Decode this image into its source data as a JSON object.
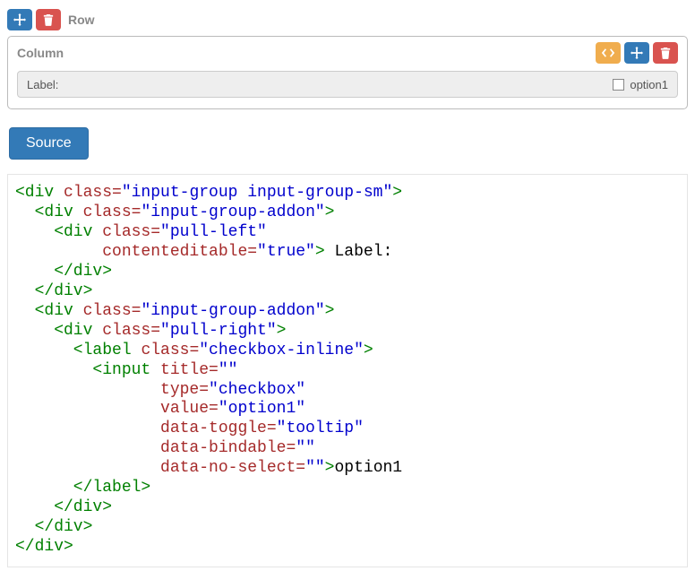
{
  "row": {
    "label": "Row"
  },
  "column": {
    "label": "Column",
    "input_label": "Label:",
    "option_label": "option1"
  },
  "source_button": "Source",
  "code": {
    "l1a": "<div ",
    "l1b": "class=",
    "l1c": "\"input-group input-group-sm\"",
    "l1d": ">",
    "l2a": "  <div ",
    "l2b": "class=",
    "l2c": "\"input-group-addon\"",
    "l2d": ">",
    "l3a": "    <div ",
    "l3b": "class=",
    "l3c": "\"pull-left\"",
    "l4b": "         contenteditable=",
    "l4c": "\"true\"",
    "l4d": "> Label:",
    "l5": "    </div>",
    "l6": "  </div>",
    "l7a": "  <div ",
    "l7b": "class=",
    "l7c": "\"input-group-addon\"",
    "l7d": ">",
    "l8a": "    <div ",
    "l8b": "class=",
    "l8c": "\"pull-right\"",
    "l8d": ">",
    "l9a": "      <label ",
    "l9b": "class=",
    "l9c": "\"checkbox-inline\"",
    "l9d": ">",
    "l10a": "        <input ",
    "l10b": "title=",
    "l10c": "\"\"",
    "l11b": "               type=",
    "l11c": "\"checkbox\"",
    "l12b": "               value=",
    "l12c": "\"option1\"",
    "l13b": "               data-toggle=",
    "l13c": "\"tooltip\"",
    "l14b": "               data-bindable=",
    "l14c": "\"\"",
    "l15b": "               data-no-select=",
    "l15c": "\"\"",
    "l15d": ">option1",
    "l16": "      </label>",
    "l17": "    </div>",
    "l18": "  </div>",
    "l19": "</div>"
  }
}
